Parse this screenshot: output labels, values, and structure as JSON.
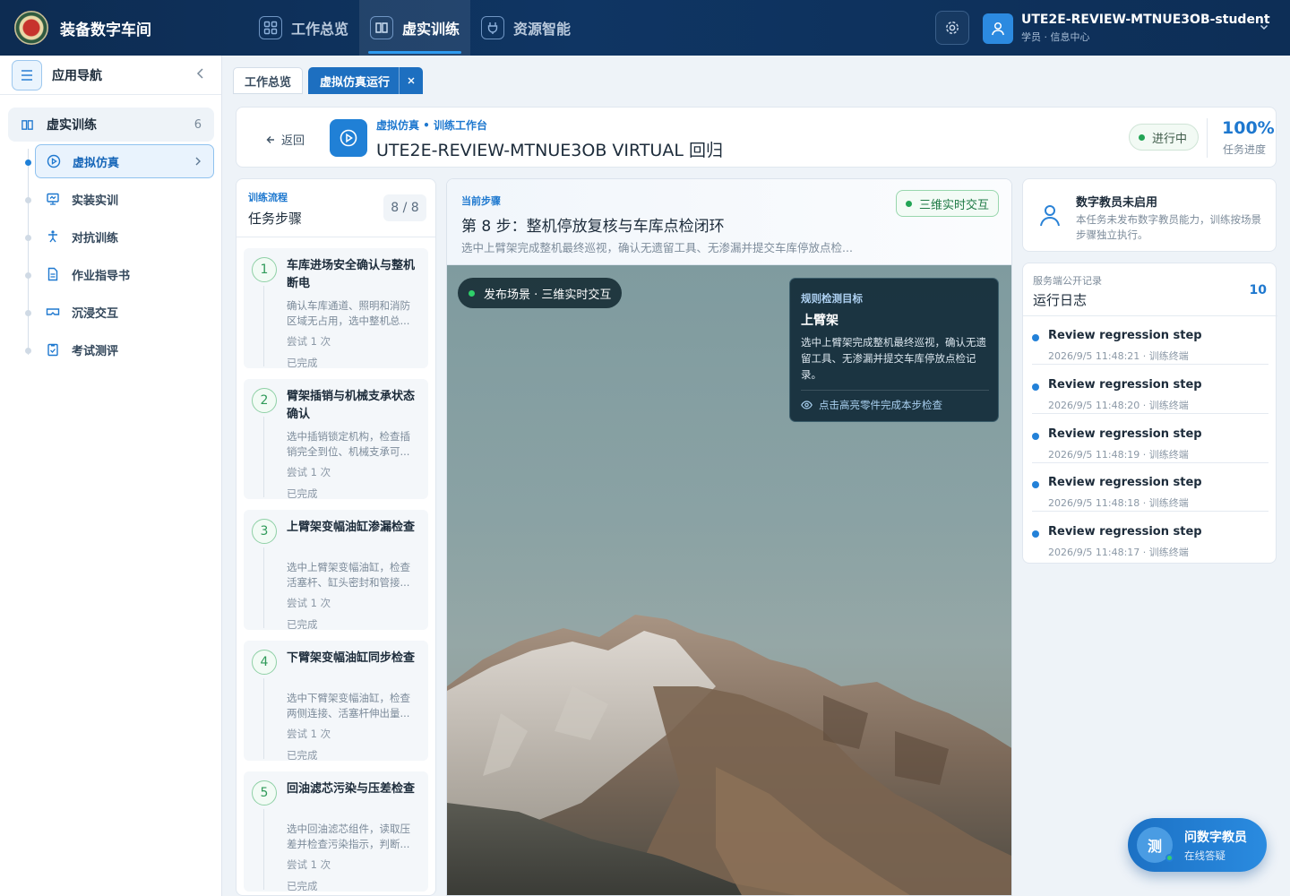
{
  "app": {
    "brand": "装备数字车间"
  },
  "topnav": [
    {
      "label": "工作总览",
      "icon": "grid-icon"
    },
    {
      "label": "虚实训练",
      "icon": "book-icon",
      "active": true
    },
    {
      "label": "资源智能",
      "icon": "plug-icon"
    }
  ],
  "user": {
    "name": "UTE2E-REVIEW-MTNUE3OB-student",
    "role": "学员 · 信息中心"
  },
  "sidebar": {
    "title": "应用导航",
    "group": {
      "label": "虚实训练",
      "count": "6"
    },
    "items": [
      {
        "label": "虚拟仿真",
        "icon": "play-circle-icon",
        "active": true
      },
      {
        "label": "实装实训",
        "icon": "monitor-icon"
      },
      {
        "label": "对抗训练",
        "icon": "figure-icon"
      },
      {
        "label": "作业指导书",
        "icon": "document-icon"
      },
      {
        "label": "沉浸交互",
        "icon": "vr-icon"
      },
      {
        "label": "考试测评",
        "icon": "clipboard-icon"
      }
    ]
  },
  "tabs": [
    {
      "label": "工作总览"
    },
    {
      "label": "虚拟仿真运行",
      "active": true
    }
  ],
  "header": {
    "back": "返回",
    "crumb": "虚拟仿真 • 训练工作台",
    "title": "UTE2E-REVIEW-MTNUE3OB VIRTUAL 回归",
    "status": "进行中",
    "progress_value": "100%",
    "progress_label": "任务进度"
  },
  "steps_panel": {
    "kicker": "训练流程",
    "title": "任务步骤",
    "counter": "8 / 8",
    "steps": [
      {
        "num": "1",
        "title": "车库进场安全确认与整机断电",
        "desc": "确认车库通道、照明和消防区域无占用，选中整机总...",
        "attempts": "尝试 1 次",
        "status": "已完成"
      },
      {
        "num": "2",
        "title": "臂架插销与机械支承状态确认",
        "desc": "选中插销锁定机构，检查插销完全到位、机械支承可...",
        "attempts": "尝试 1 次",
        "status": "已完成"
      },
      {
        "num": "3",
        "title": "上臂架变幅油缸渗漏检查",
        "desc": "选中上臂架变幅油缸，检查活塞杆、缸头密封和管接...",
        "attempts": "尝试 1 次",
        "status": "已完成"
      },
      {
        "num": "4",
        "title": "下臂架变幅油缸同步检查",
        "desc": "选中下臂架变幅油缸，检查两侧连接、活塞杆伸出量...",
        "attempts": "尝试 1 次",
        "status": "已完成"
      },
      {
        "num": "5",
        "title": "回油滤芯污染与压差检查",
        "desc": "选中回油滤芯组件，读取压差并检查污染指示，判断...",
        "attempts": "尝试 1 次",
        "status": "已完成"
      }
    ]
  },
  "center": {
    "kicker": "当前步骤",
    "title": "第 8 步：整机停放复核与车库点检闭环",
    "desc": "选中上臂架完成整机最终巡视，确认无遗留工具、无渗漏并提交车库停放点检...",
    "badge": "三维实时交互",
    "scene_badge": "发布场景 · 三维实时交互",
    "tooltip": {
      "kicker": "规则检测目标",
      "title": "上臂架",
      "desc": "选中上臂架完成整机最终巡视，确认无遗留工具、无渗漏并提交车库停放点检记录。",
      "link": "点击高亮零件完成本步检查"
    }
  },
  "tutor": {
    "title": "数字教员未启用",
    "desc": "本任务未发布数字教员能力，训练按场景步骤独立执行。"
  },
  "logs": {
    "kicker": "服务端公开记录",
    "title": "运行日志",
    "count": "10",
    "items": [
      {
        "message": "Review regression step",
        "meta": "2026/9/5 11:48:21 · 训练终端"
      },
      {
        "message": "Review regression step",
        "meta": "2026/9/5 11:48:20 · 训练终端"
      },
      {
        "message": "Review regression step",
        "meta": "2026/9/5 11:48:19 · 训练终端"
      },
      {
        "message": "Review regression step",
        "meta": "2026/9/5 11:48:18 · 训练终端"
      },
      {
        "message": "Review regression step",
        "meta": "2026/9/5 11:48:17 · 训练终端"
      }
    ]
  },
  "assistant": {
    "avatar_char": "测",
    "title": "问数字教员",
    "subtitle": "在线答疑"
  },
  "colors": {
    "brand_dark": "#0f3563",
    "accent": "#1e78cf",
    "success": "#22a455"
  }
}
